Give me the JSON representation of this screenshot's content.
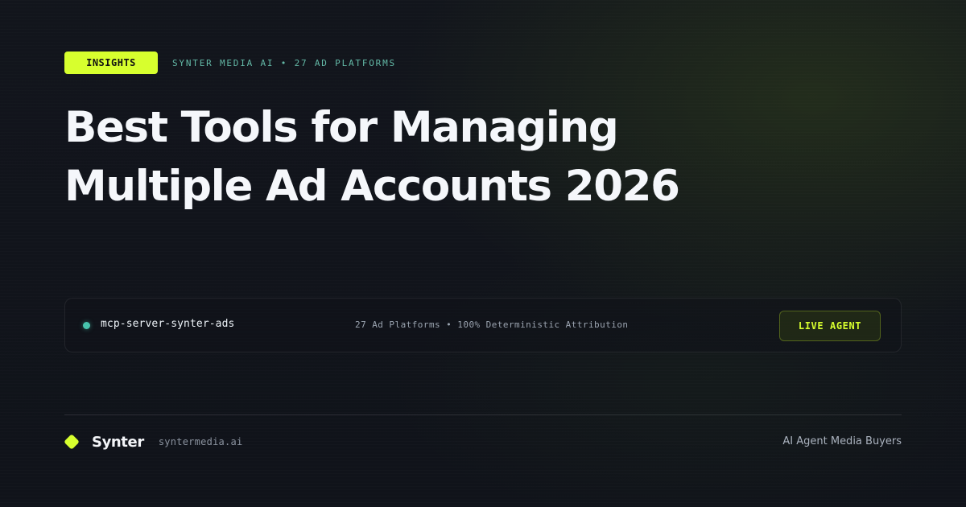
{
  "header": {
    "badge": "INSIGHTS",
    "meta": "SYNTER MEDIA AI • 27 AD PLATFORMS"
  },
  "headline": {
    "lines": [
      "Best Tools for Managing",
      "Multiple Ad Accounts 2026"
    ]
  },
  "agent_bar": {
    "server_name": "mcp-server-synter-ads",
    "details": "27 Ad Platforms • 100% Deterministic Attribution",
    "button_label": "LIVE AGENT"
  },
  "footer": {
    "brand": "Synter",
    "url": "syntermedia.ai",
    "tagline": "AI Agent Media Buyers"
  },
  "icons": {
    "logo": "diamond-logo-icon",
    "status": "status-dot-icon"
  },
  "colors": {
    "accent": "#d7ff2e",
    "status": "#47c4ad",
    "background": "#11141b"
  }
}
